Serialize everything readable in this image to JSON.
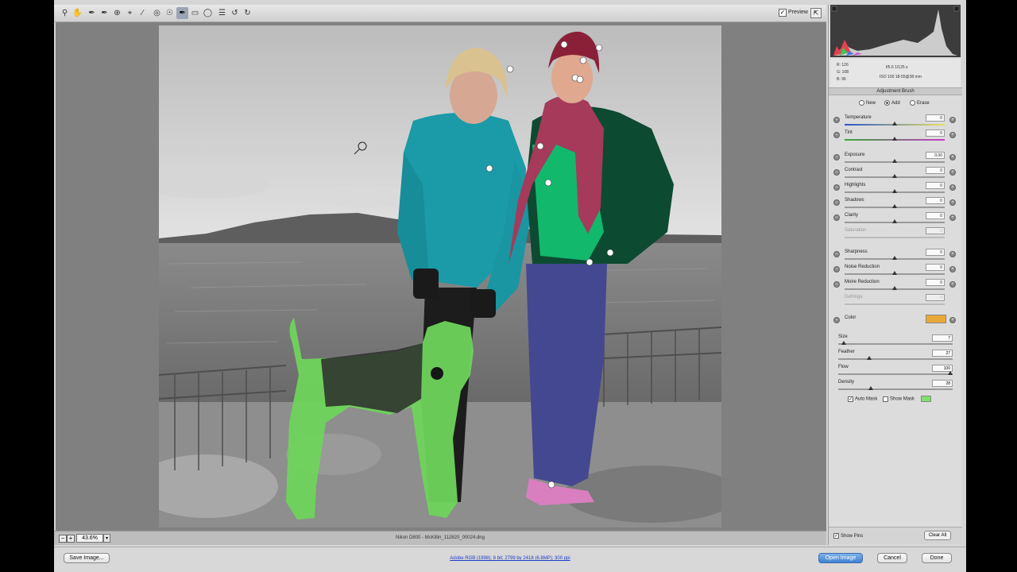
{
  "toolbar": {
    "tools": [
      "zoom-tool",
      "hand-tool",
      "white-balance-tool",
      "color-sampler-tool",
      "targeted-adjustment-tool",
      "crop-tool",
      "straighten-tool",
      "spot-removal-tool",
      "red-eye-tool",
      "adjustment-brush-tool",
      "graduated-filter-tool",
      "radial-filter-tool",
      "preferences-tool",
      "rotate-left-tool",
      "rotate-right-tool"
    ],
    "preview_label": "Preview"
  },
  "status": {
    "zoom": "43.6%",
    "filename": "Nikon D800  -  McKillin_112820_00024.dng"
  },
  "info": {
    "r": "R:  126",
    "g": "G:  108",
    "b": "B:   96",
    "exposure": "f/5.6    1/125 s",
    "lens": "ISO 100    18-55@38 mm"
  },
  "panel": {
    "title": "Adjustment Brush",
    "mode_new": "New",
    "mode_add": "Add",
    "mode_erase": "Erase",
    "color_label": "Color",
    "color_value": "#e8a838",
    "show_pins": "Show Pins",
    "clear_all": "Clear All"
  },
  "sliders": [
    {
      "label": "Temperature",
      "value": "0"
    },
    {
      "label": "Tint",
      "value": "0"
    },
    {
      "label": "Exposure",
      "value": "0.00"
    },
    {
      "label": "Contrast",
      "value": "0"
    },
    {
      "label": "Highlights",
      "value": "0"
    },
    {
      "label": "Shadows",
      "value": "0"
    },
    {
      "label": "Clarity",
      "value": "0"
    },
    {
      "label": "Saturation",
      "value": "0"
    },
    {
      "label": "Sharpness",
      "value": "0"
    },
    {
      "label": "Noise Reduction",
      "value": "0"
    },
    {
      "label": "Moire Reduction",
      "value": "0"
    },
    {
      "label": "Defringe",
      "value": "0"
    }
  ],
  "brush": [
    {
      "label": "Size",
      "value": "7"
    },
    {
      "label": "Feather",
      "value": "27"
    },
    {
      "label": "Flow",
      "value": "100"
    },
    {
      "label": "Density",
      "value": "28"
    }
  ],
  "mask": {
    "auto_mask": "Auto Mask",
    "show_mask": "Show Mask",
    "mask_color": "#7fe06a"
  },
  "bottom": {
    "save": "Save Image...",
    "workflow_link": "Adobe RGB (1998); 8 bit; 2799 by 2418 (6.8MP); 300 ppi",
    "open": "Open Image",
    "cancel": "Cancel",
    "done": "Done"
  }
}
